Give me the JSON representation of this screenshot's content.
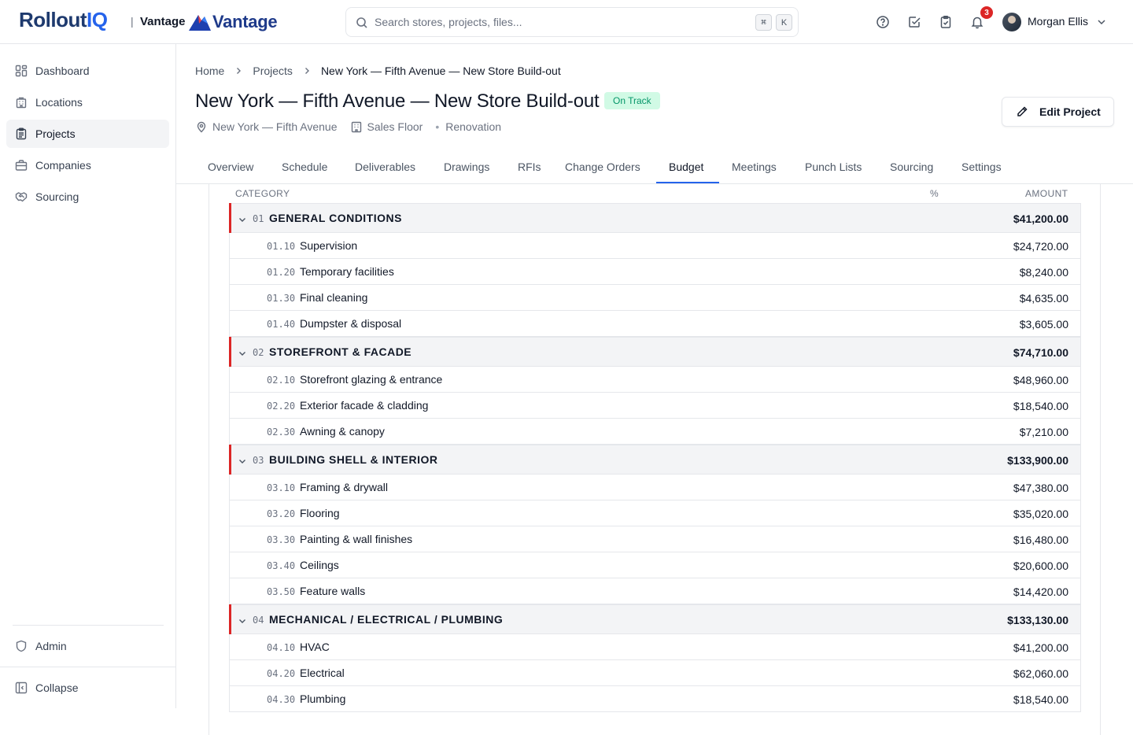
{
  "app": {
    "logo_main": "Rollout",
    "logo_accent": "IQ",
    "separator": "|",
    "tenant": "Vantage",
    "tenant_logo_text": "Vantage"
  },
  "search": {
    "placeholder": "Search stores, projects, files...",
    "shortcut_keys": [
      "⌘",
      "K"
    ]
  },
  "header_icons": [
    "help-icon",
    "tasks-icon",
    "clipboard-icon",
    "bell-icon"
  ],
  "notifications": {
    "count": "3"
  },
  "user": {
    "name": "Morgan Ellis"
  },
  "sidebar": {
    "items": [
      {
        "label": "Dashboard",
        "icon": "dashboard-icon",
        "active": false
      },
      {
        "label": "Locations",
        "icon": "building-icon",
        "active": false
      },
      {
        "label": "Projects",
        "icon": "clipboard-icon",
        "active": true
      },
      {
        "label": "Companies",
        "icon": "briefcase-icon",
        "active": false
      },
      {
        "label": "Sourcing",
        "icon": "handshake-icon",
        "active": false
      }
    ],
    "admin_label": "Admin",
    "collapse_label": "Collapse"
  },
  "breadcrumb": [
    "Home",
    "Projects",
    "New York — Fifth Avenue — New Store Build-out"
  ],
  "project": {
    "title": "New York — Fifth Avenue — New Store Build-out",
    "status": "On Track",
    "location": "New York — Fifth Avenue",
    "area": "Sales Floor",
    "type": "Renovation",
    "edit_label": "Edit Project"
  },
  "tabs": [
    {
      "label": "Overview"
    },
    {
      "label": "Schedule"
    },
    {
      "label": "Deliverables"
    },
    {
      "label": "Drawings"
    },
    {
      "label": "RFIs"
    },
    {
      "label": "Change Orders"
    },
    {
      "label": "Budget",
      "active": true
    },
    {
      "label": "Meetings"
    },
    {
      "label": "Punch Lists"
    },
    {
      "label": "Sourcing"
    },
    {
      "label": "Settings"
    }
  ],
  "colors": {
    "accent": "#2563eb",
    "group_bar": "#dc2626",
    "status_bg": "#d1fae5",
    "status_text": "#059669"
  },
  "budget": {
    "columns": {
      "category": "CATEGORY",
      "percent": "%",
      "amount": "AMOUNT"
    },
    "groups": [
      {
        "code": "01",
        "name": "GENERAL CONDITIONS",
        "amount": "$41,200.00",
        "items": [
          {
            "code": "01.10",
            "name": "Supervision",
            "amount": "$24,720.00"
          },
          {
            "code": "01.20",
            "name": "Temporary facilities",
            "amount": "$8,240.00"
          },
          {
            "code": "01.30",
            "name": "Final cleaning",
            "amount": "$4,635.00"
          },
          {
            "code": "01.40",
            "name": "Dumpster & disposal",
            "amount": "$3,605.00"
          }
        ]
      },
      {
        "code": "02",
        "name": "STOREFRONT & FACADE",
        "amount": "$74,710.00",
        "items": [
          {
            "code": "02.10",
            "name": "Storefront glazing & entrance",
            "amount": "$48,960.00"
          },
          {
            "code": "02.20",
            "name": "Exterior facade & cladding",
            "amount": "$18,540.00"
          },
          {
            "code": "02.30",
            "name": "Awning & canopy",
            "amount": "$7,210.00"
          }
        ]
      },
      {
        "code": "03",
        "name": "BUILDING SHELL & INTERIOR",
        "amount": "$133,900.00",
        "items": [
          {
            "code": "03.10",
            "name": "Framing & drywall",
            "amount": "$47,380.00"
          },
          {
            "code": "03.20",
            "name": "Flooring",
            "amount": "$35,020.00"
          },
          {
            "code": "03.30",
            "name": "Painting & wall finishes",
            "amount": "$16,480.00"
          },
          {
            "code": "03.40",
            "name": "Ceilings",
            "amount": "$20,600.00"
          },
          {
            "code": "03.50",
            "name": "Feature walls",
            "amount": "$14,420.00"
          }
        ]
      },
      {
        "code": "04",
        "name": "MECHANICAL / ELECTRICAL / PLUMBING",
        "amount": "$133,130.00",
        "items": [
          {
            "code": "04.10",
            "name": "HVAC",
            "amount": "$41,200.00"
          },
          {
            "code": "04.20",
            "name": "Electrical",
            "amount": "$62,060.00"
          },
          {
            "code": "04.30",
            "name": "Plumbing",
            "amount": "$18,540.00"
          }
        ]
      }
    ]
  }
}
